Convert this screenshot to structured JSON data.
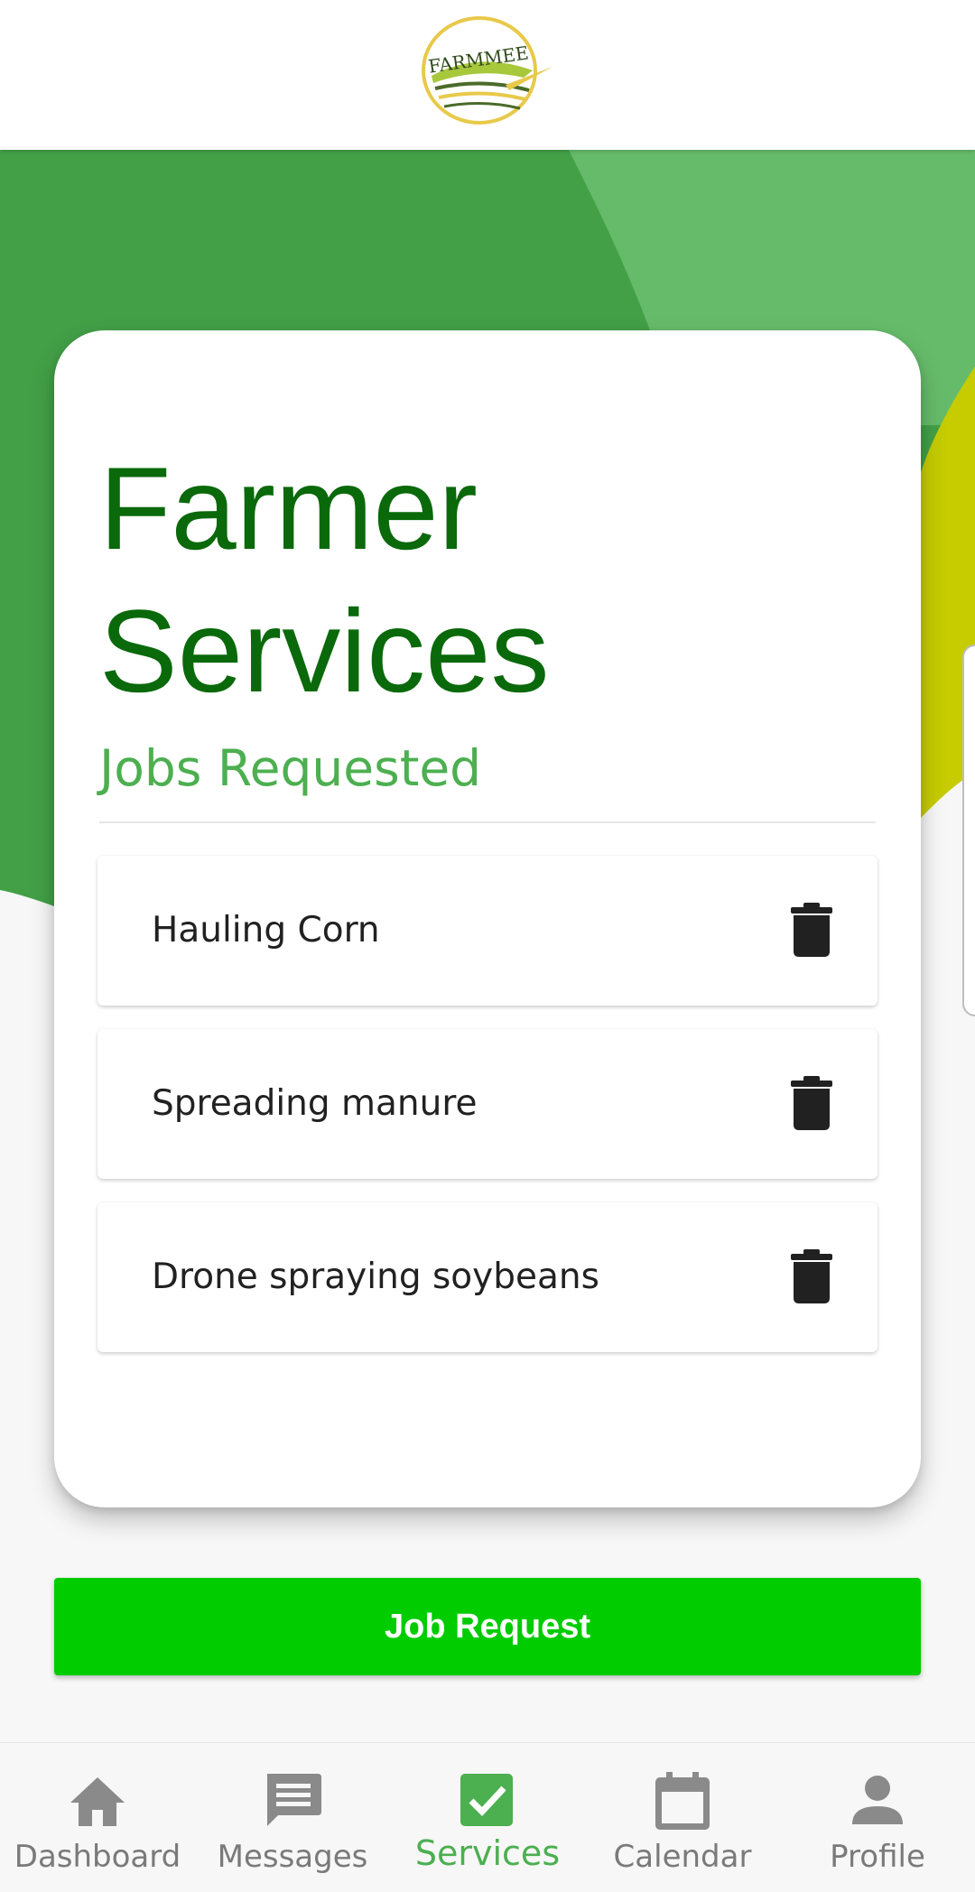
{
  "header": {
    "logo_text": "FARMMEE"
  },
  "main": {
    "title_line1": "Farmer",
    "title_line2": "Services",
    "subtitle": "Jobs Requested",
    "jobs": [
      {
        "label": "Hauling Corn",
        "action_icon": "trash-icon"
      },
      {
        "label": "Spreading manure",
        "action_icon": "trash-icon"
      },
      {
        "label": "Drone spraying soybeans",
        "action_icon": "trash-icon"
      }
    ],
    "job_request_button": "Job Request"
  },
  "bottom_nav": {
    "active": "Services",
    "items": [
      {
        "label": "Dashboard",
        "icon": "home-icon"
      },
      {
        "label": "Messages",
        "icon": "message-icon"
      },
      {
        "label": "Services",
        "icon": "checkbox-icon"
      },
      {
        "label": "Calendar",
        "icon": "calendar-icon"
      },
      {
        "label": "Profile",
        "icon": "person-icon"
      }
    ]
  },
  "colors": {
    "title": "#0a690a",
    "subtitle": "#4caf50",
    "button": "#00cc00",
    "background_green_dark": "#43a047",
    "background_green_light": "#66bb6a",
    "background_yellow": "#c6cc00",
    "nav_active": "#4caf50",
    "nav_inactive": "#7a7a7a"
  }
}
